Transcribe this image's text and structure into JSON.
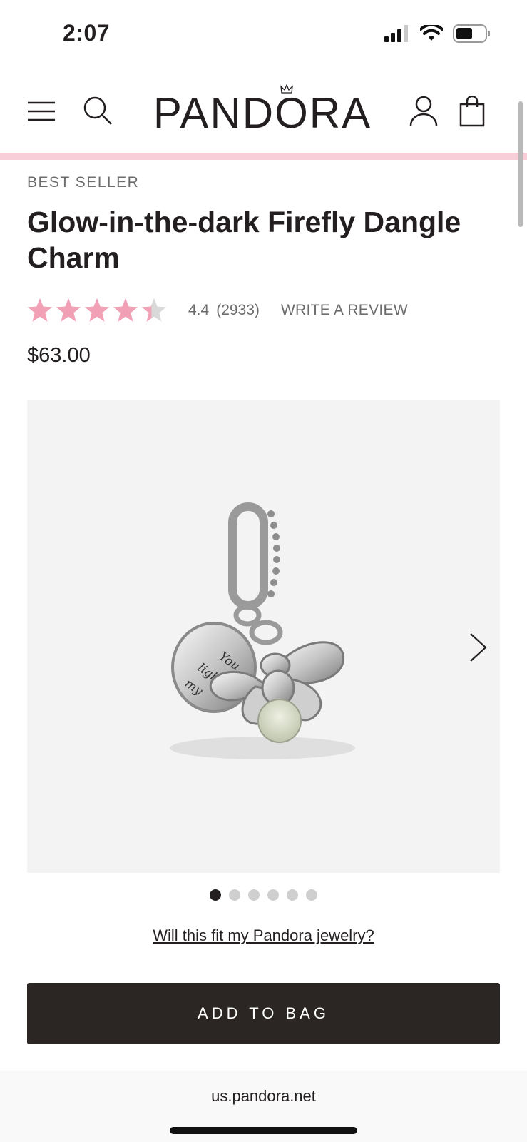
{
  "status_bar": {
    "time": "2:07"
  },
  "header": {
    "logo_text": "PANDORA",
    "icons": [
      "menu-icon",
      "search-icon",
      "account-icon",
      "bag-icon"
    ]
  },
  "product": {
    "eyebrow": "BEST SELLER",
    "title": "Glow-in-the-dark Firefly Dangle Charm",
    "rating": "4.4",
    "rating_value": 4.4,
    "rating_max": 5,
    "review_count": "(2933)",
    "write_review": "WRITE A REVIEW",
    "price": "$63.00"
  },
  "gallery": {
    "image_count": 6,
    "active_index": 0,
    "engraving": "You light up my"
  },
  "fit_link": "Will this fit my Pandora jewelry?",
  "add_to_bag": "ADD TO BAG",
  "browser": {
    "url": "us.pandora.net"
  },
  "colors": {
    "accent_pink": "#f8cfd9",
    "star_pink": "#f2a0b6",
    "text": "#231f20",
    "button_bg": "#2b2624"
  }
}
